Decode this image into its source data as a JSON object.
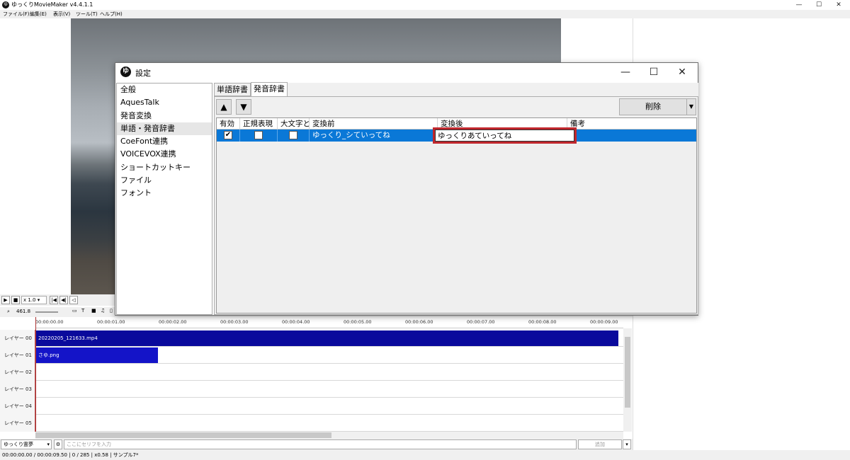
{
  "app": {
    "title": "ゆっくりMovieMaker v4.4.1.1",
    "icon_letter": "ゆ",
    "menu": [
      "ファイル(F)",
      "編集(E)",
      "表示(V)",
      "ツール(T)",
      "ヘルプ(H)"
    ]
  },
  "window_controls": {
    "minimize": "—",
    "maximize": "☐",
    "close": "✕"
  },
  "playback": {
    "speed": "x 1.0",
    "zoom": "461.8"
  },
  "timeline": {
    "ruler": [
      "00:00:00.00",
      "00:00:01.00",
      "00:00:02.00",
      "00:00:03.00",
      "00:00:04.00",
      "00:00:05.00",
      "00:00:06.00",
      "00:00:07.00",
      "00:00:08.00",
      "00:00:09.00"
    ],
    "layers": [
      "レイヤー 00",
      "レイヤー 01",
      "レイヤー 02",
      "レイヤー 03",
      "レイヤー 04",
      "レイヤー 05"
    ],
    "clips": {
      "video": "20220205_121633.mp4",
      "image": "さゆ.png"
    },
    "clip_colors": {
      "video": "#0a0a9c",
      "image": "#1414c8"
    }
  },
  "speaker_bar": {
    "speaker": "ゆっくり霊夢",
    "serif_placeholder": "ここにセリフを入力",
    "add_button": "追加"
  },
  "status": {
    "text": "00:00:00.00  /  00:00:09.50  |  0  /  285  |  x0.58  |  サンプル7*"
  },
  "dialog": {
    "title": "設定",
    "nav_items": [
      "全般",
      "AquesTalk",
      "発音変換",
      "単語・発音辞書",
      "CoeFont連携",
      "VOICEVOX連携",
      "ショートカットキー",
      "ファイル",
      "フォント"
    ],
    "active_nav": "単語・発音辞書",
    "tabs": [
      "単語辞書",
      "発音辞書"
    ],
    "active_tab": "発音辞書",
    "up_button": "▲",
    "down_button": "▼",
    "delete_button": "削除",
    "columns": [
      "有効",
      "正規表現",
      "大文字と",
      "変換前",
      "変換後",
      "備考"
    ],
    "row": {
      "enabled": true,
      "regex": false,
      "case": false,
      "before": "ゆっくり_シていってね",
      "after": "ゆっくりあていってね",
      "note": ""
    },
    "selection_color": "#0a78d7",
    "highlight_color": "#c1272d"
  }
}
